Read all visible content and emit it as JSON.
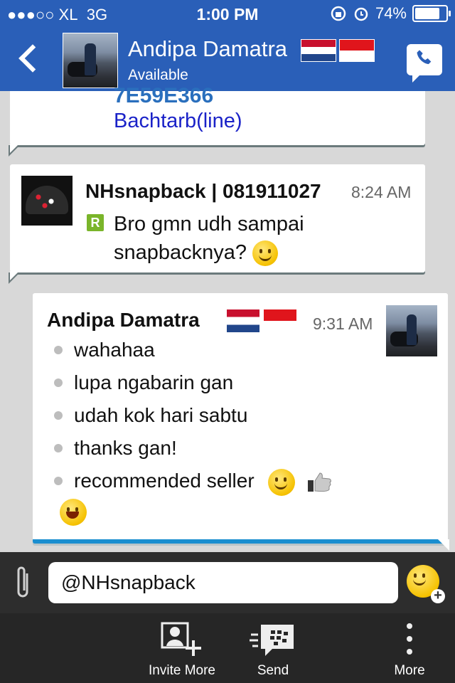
{
  "status_bar": {
    "carrier": "●●●○○ XL",
    "network": "3G",
    "time": "1:00 PM",
    "battery": "74%",
    "battery_level": 0.74
  },
  "header": {
    "contact_name": "Andipa Damatra",
    "contact_status": "Available"
  },
  "messages": [
    {
      "pin": "7E59E366",
      "line": "Bachtarb(line)"
    },
    {
      "sender": "NHsnapback | 081911027",
      "time": "8:24 AM",
      "badge": "R",
      "text": "Bro gmn udh sampai snapbacknya?"
    },
    {
      "sender": "Andipa Damatra",
      "time": "9:31 AM",
      "lines": [
        "wahahaa",
        "lupa ngabarin gan",
        "udah kok hari sabtu",
        "thanks gan!",
        "recommended seller"
      ]
    }
  ],
  "composer": {
    "value": "@NHsnapback"
  },
  "bottom_bar": {
    "invite_label": "Invite More",
    "send_label": "Send",
    "more_label": "More"
  },
  "colors": {
    "header_bg": "#2a5fb8",
    "accent": "#1a8ed0",
    "bottom_bg": "#262626"
  }
}
